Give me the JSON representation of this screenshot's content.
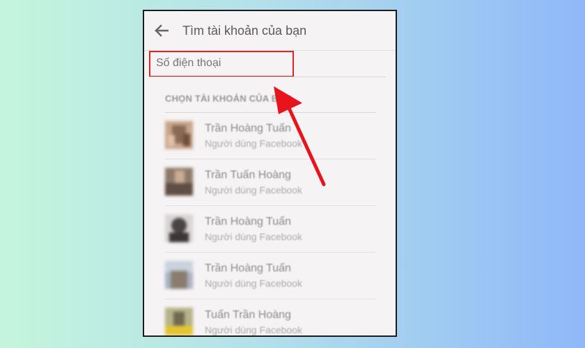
{
  "header": {
    "title": "Tìm tài khoản của bạn",
    "back_icon": "arrow-left-icon"
  },
  "search": {
    "placeholder": "Số điện thoại",
    "value": ""
  },
  "section": {
    "title": "CHỌN TÀI KHOẢN CỦA BẠN"
  },
  "accounts": [
    {
      "name": "Trần Hoàng Tuấn",
      "subtitle": "Người dùng Facebook"
    },
    {
      "name": "Trần Tuấn Hoàng",
      "subtitle": "Người dùng Facebook"
    },
    {
      "name": "Trần Hoàng Tuấn",
      "subtitle": "Người dùng Facebook"
    },
    {
      "name": "Trần Hoàng Tuấn",
      "subtitle": "Người dùng Facebook"
    },
    {
      "name": "Tuấn Trần Hoàng",
      "subtitle": "Người dùng Facebook"
    }
  ],
  "colors": {
    "highlight": "#e32222",
    "arrow": "#e8141b"
  }
}
